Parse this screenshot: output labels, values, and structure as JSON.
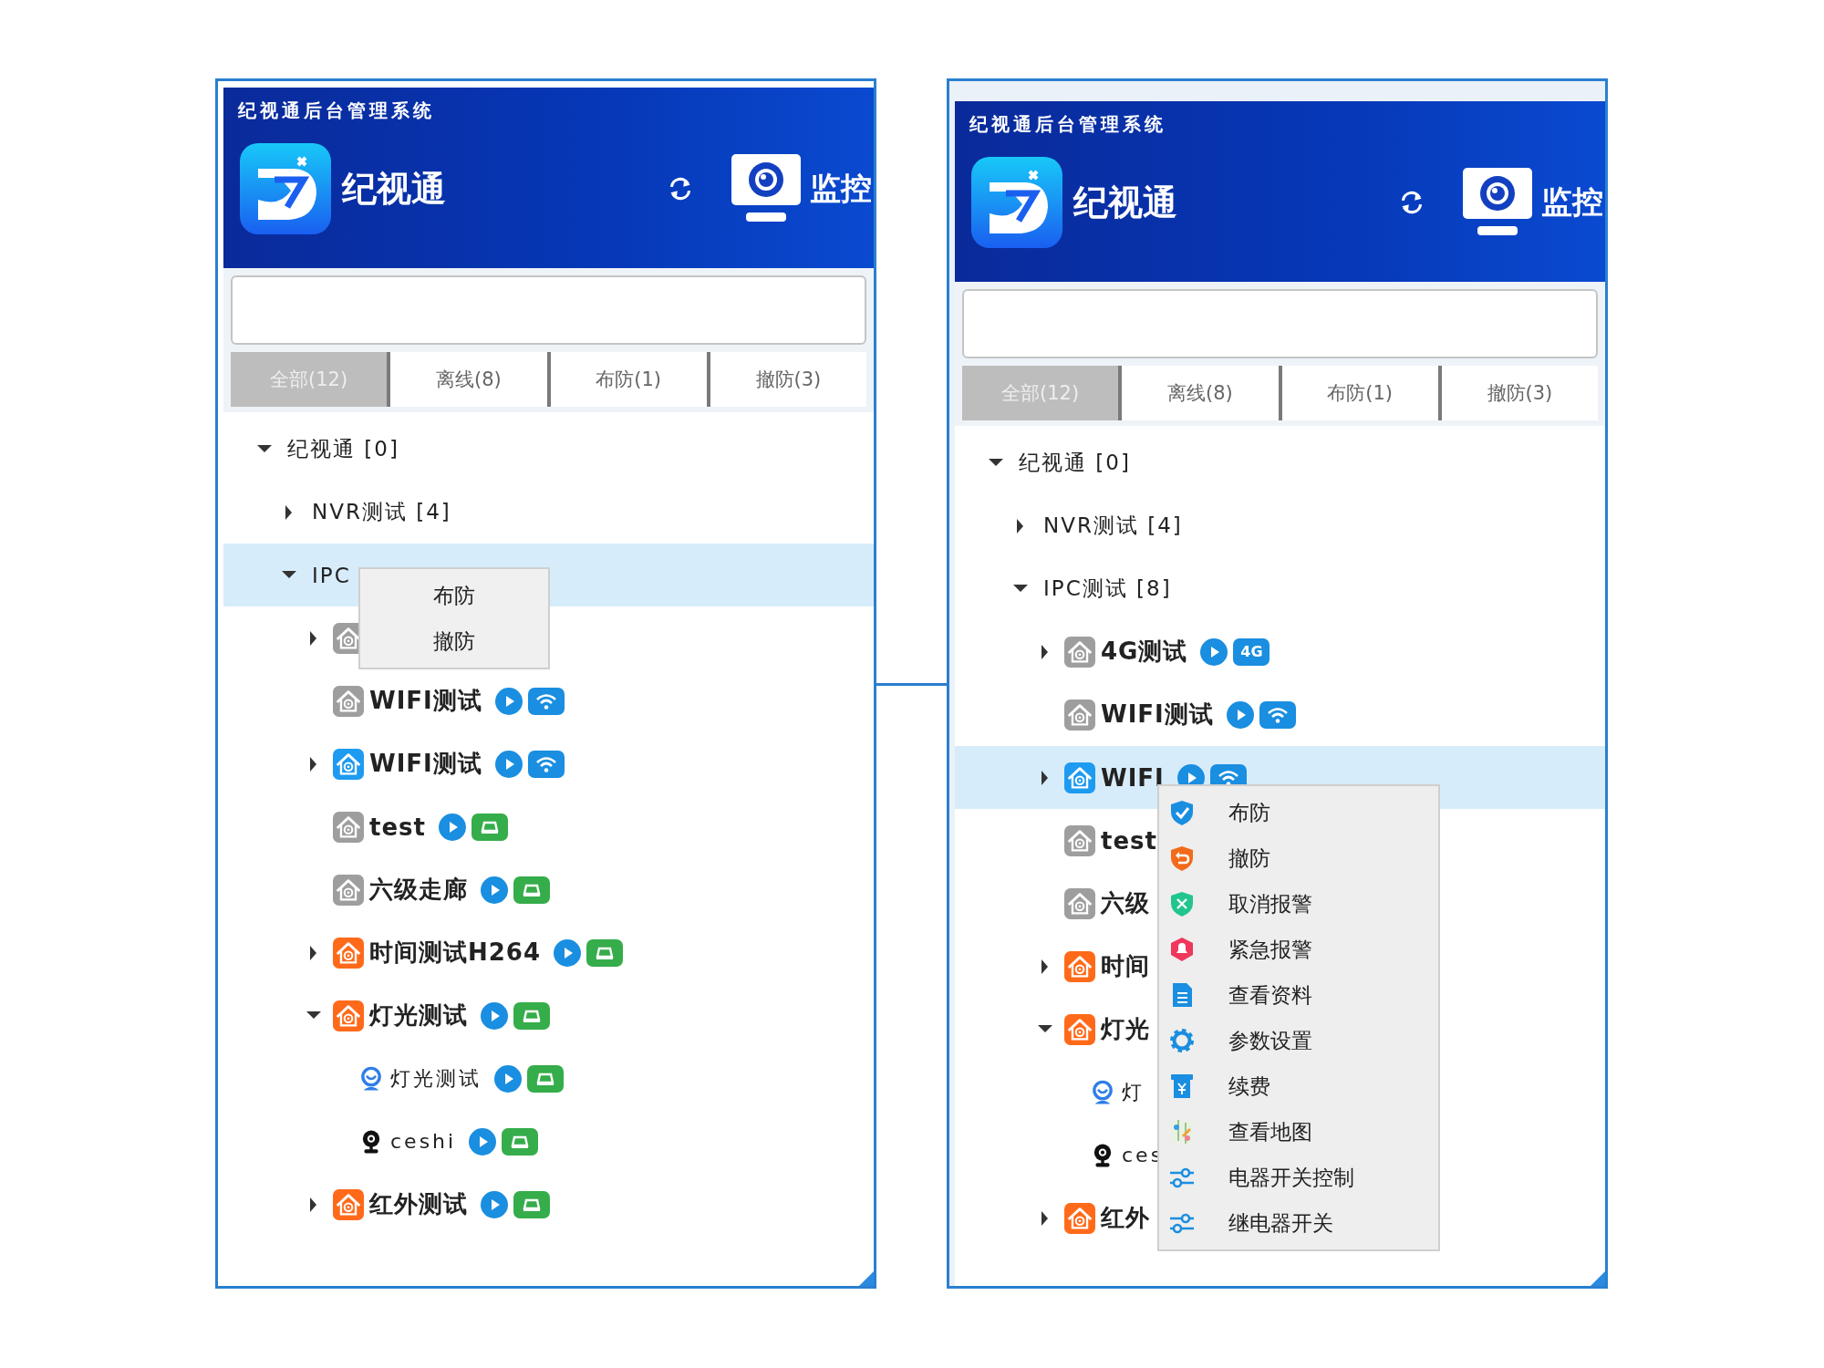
{
  "panels": [
    {
      "window_title": "纪视通后台管理系统",
      "app_name": "纪视通",
      "monitor_label": "监控",
      "tabs": [
        {
          "label": "全部(12)",
          "selected": true
        },
        {
          "label": "离线(8)",
          "selected": false
        },
        {
          "label": "布防(1)",
          "selected": false
        },
        {
          "label": "撤防(3)",
          "selected": false
        }
      ],
      "tree": [
        {
          "kind": "group",
          "label": "纪视通 [0]",
          "expanded": true,
          "selected": false,
          "children": [
            {
              "kind": "group",
              "label": "NVR测试 [4]",
              "expanded": false,
              "selected": false
            },
            {
              "kind": "group",
              "label": "IPC",
              "expanded": true,
              "selected": true,
              "context_menu": {
                "kind": "plain",
                "items": [
                  {
                    "label": "布防"
                  },
                  {
                    "label": "撤防"
                  }
                ]
              },
              "children": [
                {
                  "kind": "house",
                  "color": "#9e9e9e",
                  "expanded": false,
                  "selected": false,
                  "play": false
                },
                {
                  "kind": "house",
                  "color": "#9e9e9e",
                  "label": "WIFI测试",
                  "selected": false,
                  "play": true,
                  "network": {
                    "kind": "wifi"
                  }
                },
                {
                  "kind": "house",
                  "color": "#1d9bf0",
                  "label": "WIFI测试",
                  "expanded": false,
                  "selected": false,
                  "play": true,
                  "network": {
                    "kind": "wifi"
                  }
                },
                {
                  "kind": "house",
                  "color": "#9e9e9e",
                  "label": "test",
                  "selected": false,
                  "play": true,
                  "network": {
                    "kind": "wired"
                  }
                },
                {
                  "kind": "house",
                  "color": "#9e9e9e",
                  "label": "六级走廊",
                  "selected": false,
                  "play": true,
                  "network": {
                    "kind": "wired"
                  }
                },
                {
                  "kind": "house",
                  "color": "#ff6a1a",
                  "label": "时间测试H264",
                  "expanded": false,
                  "selected": false,
                  "play": true,
                  "network": {
                    "kind": "wired"
                  }
                },
                {
                  "kind": "house",
                  "color": "#ff6a1a",
                  "label": "灯光测试",
                  "expanded": true,
                  "selected": false,
                  "play": true,
                  "network": {
                    "kind": "wired"
                  },
                  "children": [
                    {
                      "kind": "camera",
                      "label": "灯光测试",
                      "selected": false,
                      "play": true,
                      "network": {
                        "kind": "wired"
                      }
                    },
                    {
                      "kind": "webcam",
                      "label": "ceshi",
                      "selected": false,
                      "play": true,
                      "network": {
                        "kind": "wired"
                      }
                    }
                  ]
                },
                {
                  "kind": "house",
                  "color": "#ff6a1a",
                  "label": "红外测试",
                  "expanded": false,
                  "selected": false,
                  "play": true,
                  "network": {
                    "kind": "wired"
                  }
                }
              ]
            }
          ]
        }
      ]
    },
    {
      "window_title": "纪视通后台管理系统",
      "app_name": "纪视通",
      "monitor_label": "监控",
      "tabs": [
        {
          "label": "全部(12)",
          "selected": true
        },
        {
          "label": "离线(8)",
          "selected": false
        },
        {
          "label": "布防(1)",
          "selected": false
        },
        {
          "label": "撤防(3)",
          "selected": false
        }
      ],
      "tree": [
        {
          "kind": "group",
          "label": "纪视通 [0]",
          "expanded": true,
          "selected": false,
          "children": [
            {
              "kind": "group",
              "label": "NVR测试 [4]",
              "expanded": false,
              "selected": false
            },
            {
              "kind": "group",
              "label": "IPC测试 [8]",
              "expanded": true,
              "selected": false,
              "children": [
                {
                  "kind": "house",
                  "color": "#9e9e9e",
                  "label": "4G测试",
                  "expanded": false,
                  "selected": false,
                  "play": true,
                  "network": {
                    "kind": "cellular",
                    "text": "4G"
                  }
                },
                {
                  "kind": "house",
                  "color": "#9e9e9e",
                  "label": "WIFI测试",
                  "selected": false,
                  "play": true,
                  "network": {
                    "kind": "wifi"
                  }
                },
                {
                  "kind": "house",
                  "color": "#1d9bf0",
                  "label": "WIFI",
                  "expanded": false,
                  "selected": true,
                  "play": true,
                  "network": {
                    "kind": "wifi"
                  },
                  "context_menu": {
                    "kind": "icons",
                    "items": [
                      {
                        "label": "布防"
                      },
                      {
                        "label": "撤防"
                      },
                      {
                        "label": "取消报警"
                      },
                      {
                        "label": "紧急报警"
                      },
                      {
                        "label": "查看资料"
                      },
                      {
                        "label": "参数设置"
                      },
                      {
                        "label": "续费"
                      },
                      {
                        "label": "查看地图"
                      },
                      {
                        "label": "电器开关控制"
                      },
                      {
                        "label": "继电器开关"
                      }
                    ]
                  }
                },
                {
                  "kind": "house",
                  "color": "#9e9e9e",
                  "label": "test",
                  "selected": false,
                  "play": false
                },
                {
                  "kind": "house",
                  "color": "#9e9e9e",
                  "label": "六级",
                  "selected": false,
                  "play": false
                },
                {
                  "kind": "house",
                  "color": "#ff6a1a",
                  "label": "时间",
                  "expanded": false,
                  "selected": false,
                  "play": false
                },
                {
                  "kind": "house",
                  "color": "#ff6a1a",
                  "label": "灯光",
                  "expanded": true,
                  "selected": false,
                  "play": false,
                  "children": [
                    {
                      "kind": "camera",
                      "label": "灯",
                      "selected": false,
                      "play": false
                    },
                    {
                      "kind": "webcam",
                      "label": "ces",
                      "selected": false,
                      "play": false
                    }
                  ]
                },
                {
                  "kind": "house",
                  "color": "#ff6a1a",
                  "label": "红外",
                  "expanded": false,
                  "selected": false,
                  "play": false
                }
              ]
            }
          ]
        }
      ]
    }
  ]
}
